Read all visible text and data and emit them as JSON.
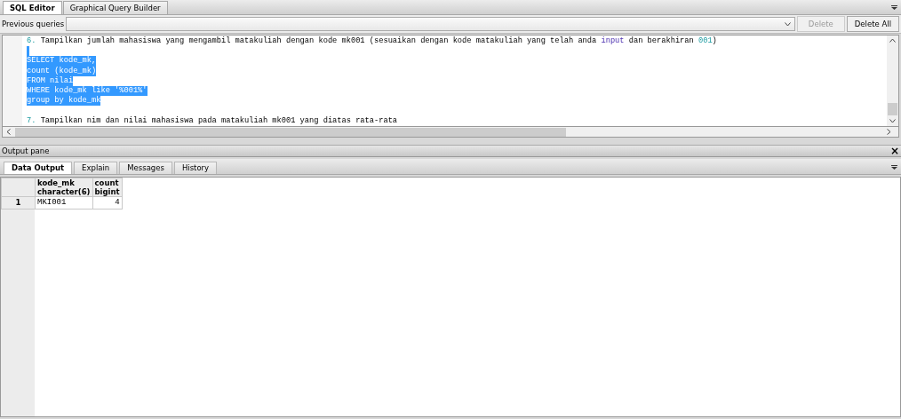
{
  "editor_tabs": [
    {
      "label": "SQL Editor",
      "selected": true
    },
    {
      "label": "Graphical Query Builder",
      "selected": false
    }
  ],
  "previous_queries": {
    "label": "Previous queries",
    "delete": {
      "label": "Delete",
      "disabled": true
    },
    "delete_all": {
      "label": "Delete All",
      "disabled": false
    }
  },
  "editor_lines": [
    {
      "selected": false,
      "segments": [
        {
          "kind": "number",
          "text": "6."
        },
        {
          "kind": "plain",
          "text": " Tampilkan jumlah mahasiswa yang mengambil matakuliah dengan kode mk001 (sesuaikan dengan kode matakuliah yang telah anda "
        },
        {
          "kind": "keyword",
          "text": "input"
        },
        {
          "kind": "plain",
          "text": " dan berakhiran "
        },
        {
          "kind": "number",
          "text": "001"
        },
        {
          "kind": "plain",
          "text": ")"
        }
      ]
    },
    {
      "kind": "blank",
      "selected": true
    },
    {
      "selected": true,
      "segments": [
        {
          "kind": "plain",
          "text": "SELECT kode_mk,"
        }
      ]
    },
    {
      "selected": true,
      "segments": [
        {
          "kind": "plain",
          "text": "count (kode_mk)"
        }
      ]
    },
    {
      "selected": true,
      "segments": [
        {
          "kind": "plain",
          "text": "FROM nilai"
        }
      ]
    },
    {
      "selected": true,
      "segments": [
        {
          "kind": "plain",
          "text": "WHERE kode_mk like '%001%'"
        }
      ]
    },
    {
      "selected": true,
      "segments": [
        {
          "kind": "plain",
          "text": "group by kode_mk"
        }
      ]
    },
    {
      "kind": "blank"
    },
    {
      "selected": false,
      "segments": [
        {
          "kind": "number",
          "text": "7."
        },
        {
          "kind": "plain",
          "text": " Tampilkan nim dan nilai mahasiswa pada matakuliah mk001 yang diatas rata-rata"
        }
      ]
    }
  ],
  "output_pane": {
    "title": "Output pane",
    "close": "×"
  },
  "output_tabs": [
    {
      "label": "Data Output",
      "selected": true
    },
    {
      "label": "Explain",
      "selected": false
    },
    {
      "label": "Messages",
      "selected": false
    },
    {
      "label": "History",
      "selected": false
    }
  ],
  "table": {
    "columns": [
      {
        "name": "kode_mk",
        "type": "character(6)",
        "kind": "text"
      },
      {
        "name": "count",
        "type": "bigint",
        "kind": "number"
      }
    ],
    "rows": [
      {
        "number": "1",
        "cells": [
          "MKI001",
          "4"
        ]
      }
    ]
  }
}
